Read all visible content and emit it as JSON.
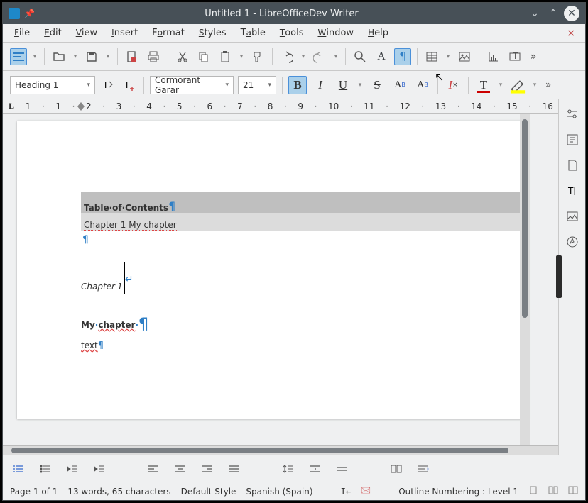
{
  "window": {
    "title": "Untitled 1 - LibreOfficeDev Writer"
  },
  "menu": {
    "file": "File",
    "edit": "Edit",
    "view": "View",
    "insert": "Insert",
    "format": "Format",
    "styles": "Styles",
    "table": "Table",
    "tools": "Tools",
    "window": "Window",
    "help": "Help"
  },
  "format": {
    "style": "Heading 1",
    "font": "Cormorant Garar",
    "size": "21"
  },
  "ruler": {
    "ticks": [
      "1",
      "1",
      "2",
      "3",
      "4",
      "5",
      "6",
      "7",
      "8",
      "9",
      "10",
      "11",
      "12",
      "13",
      "14",
      "15",
      "16"
    ]
  },
  "doc": {
    "toc_heading": "Table·of·Contents",
    "toc_line": "Chapter 1  My chapter",
    "chapter": "Chapter",
    "chapter_num": "1",
    "subtitle_a": "My",
    "subtitle_b": "chapter",
    "body": "text"
  },
  "status": {
    "page": "Page 1 of 1",
    "words": "13 words, 65 characters",
    "style": "Default Style",
    "lang": "Spanish (Spain)",
    "outline": "Outline Numbering : Level 1"
  }
}
